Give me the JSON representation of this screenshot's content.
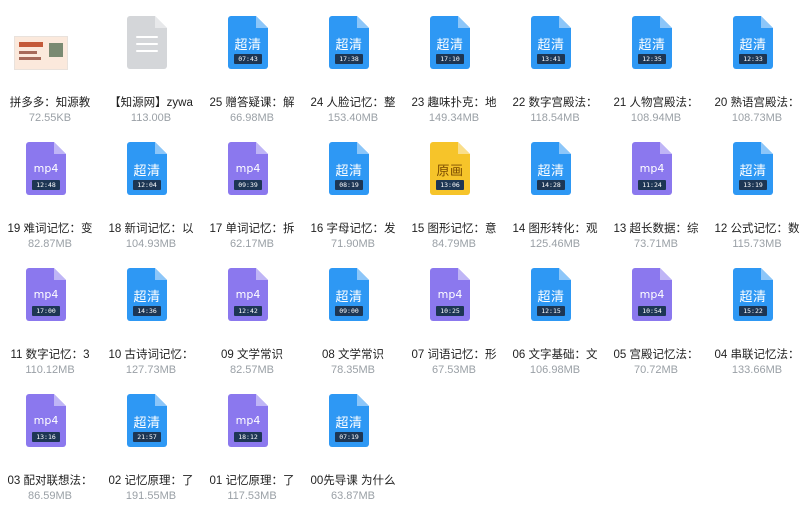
{
  "colors": {
    "hd": "#2e98f4",
    "mp4": "#8b78ee",
    "raw": "#f6c42a",
    "doc": "#d4d6d9"
  },
  "files": [
    {
      "kind": "thumb",
      "name": "拼多多：知源教",
      "size": "72.55KB",
      "icon": "image-thumbnail-icon"
    },
    {
      "kind": "doc",
      "name": "【知源网】zywa",
      "size": "113.00B",
      "icon": "document-icon"
    },
    {
      "kind": "hd",
      "label": "超清",
      "duration": "07:43",
      "name": "25 赠答疑课：解",
      "size": "66.98MB",
      "icon": "video-hd-icon"
    },
    {
      "kind": "hd",
      "label": "超清",
      "duration": "17:38",
      "name": "24 人脸记忆：整",
      "size": "153.40MB",
      "icon": "video-hd-icon"
    },
    {
      "kind": "hd",
      "label": "超清",
      "duration": "17:10",
      "name": "23 趣味扑克：地",
      "size": "149.34MB",
      "icon": "video-hd-icon"
    },
    {
      "kind": "hd",
      "label": "超清",
      "duration": "13:41",
      "name": "22 数字宫殿法：",
      "size": "118.54MB",
      "icon": "video-hd-icon"
    },
    {
      "kind": "hd",
      "label": "超清",
      "duration": "12:35",
      "name": "21 人物宫殿法：",
      "size": "108.94MB",
      "icon": "video-hd-icon"
    },
    {
      "kind": "hd",
      "label": "超清",
      "duration": "12:33",
      "name": "20 熟语宫殿法：",
      "size": "108.73MB",
      "icon": "video-hd-icon"
    },
    {
      "kind": "mp4",
      "label": "mp4",
      "duration": "12:48",
      "name": "19 难词记忆：变",
      "size": "82.87MB",
      "icon": "video-mp4-icon"
    },
    {
      "kind": "hd",
      "label": "超清",
      "duration": "12:04",
      "name": "18 新词记忆：以",
      "size": "104.93MB",
      "icon": "video-hd-icon"
    },
    {
      "kind": "mp4",
      "label": "mp4",
      "duration": "09:39",
      "name": "17 单词记忆：拆",
      "size": "62.17MB",
      "icon": "video-mp4-icon"
    },
    {
      "kind": "hd",
      "label": "超清",
      "duration": "08:19",
      "name": "16 字母记忆：发",
      "size": "71.90MB",
      "icon": "video-hd-icon"
    },
    {
      "kind": "raw",
      "label": "原画",
      "duration": "13:06",
      "name": "15 图形记忆：意",
      "size": "84.79MB",
      "icon": "video-original-icon"
    },
    {
      "kind": "hd",
      "label": "超清",
      "duration": "14:28",
      "name": "14 图形转化：观",
      "size": "125.46MB",
      "icon": "video-hd-icon"
    },
    {
      "kind": "mp4",
      "label": "mp4",
      "duration": "11:24",
      "name": "13 超长数据：综",
      "size": "73.71MB",
      "icon": "video-mp4-icon"
    },
    {
      "kind": "hd",
      "label": "超清",
      "duration": "13:19",
      "name": "12 公式记忆：数",
      "size": "115.73MB",
      "icon": "video-hd-icon"
    },
    {
      "kind": "mp4",
      "label": "mp4",
      "duration": "17:00",
      "name": "11 数字记忆：3",
      "size": "110.12MB",
      "icon": "video-mp4-icon"
    },
    {
      "kind": "hd",
      "label": "超清",
      "duration": "14:36",
      "name": "10 古诗词记忆：",
      "size": "127.73MB",
      "icon": "video-hd-icon"
    },
    {
      "kind": "mp4",
      "label": "mp4",
      "duration": "12:42",
      "name": "09 文学常识",
      "size": "82.57MB",
      "icon": "video-mp4-icon"
    },
    {
      "kind": "hd",
      "label": "超清",
      "duration": "09:00",
      "name": "08 文学常识",
      "size": "78.35MB",
      "icon": "video-hd-icon"
    },
    {
      "kind": "mp4",
      "label": "mp4",
      "duration": "10:25",
      "name": "07 词语记忆：形",
      "size": "67.53MB",
      "icon": "video-mp4-icon"
    },
    {
      "kind": "hd",
      "label": "超清",
      "duration": "12:15",
      "name": "06 文字基础：文",
      "size": "106.98MB",
      "icon": "video-hd-icon"
    },
    {
      "kind": "mp4",
      "label": "mp4",
      "duration": "10:54",
      "name": "05 宫殿记忆法：",
      "size": "70.72MB",
      "icon": "video-mp4-icon"
    },
    {
      "kind": "hd",
      "label": "超清",
      "duration": "15:22",
      "name": "04 串联记忆法：",
      "size": "133.66MB",
      "icon": "video-hd-icon"
    },
    {
      "kind": "mp4",
      "label": "mp4",
      "duration": "13:16",
      "name": "03 配对联想法：",
      "size": "86.59MB",
      "icon": "video-mp4-icon"
    },
    {
      "kind": "hd",
      "label": "超清",
      "duration": "21:57",
      "name": "02 记忆原理：了",
      "size": "191.55MB",
      "icon": "video-hd-icon"
    },
    {
      "kind": "mp4",
      "label": "mp4",
      "duration": "18:12",
      "name": "01 记忆原理：了",
      "size": "117.53MB",
      "icon": "video-mp4-icon"
    },
    {
      "kind": "hd",
      "label": "超清",
      "duration": "07:19",
      "name": "00先导课 为什么",
      "size": "63.87MB",
      "icon": "video-hd-icon"
    }
  ]
}
